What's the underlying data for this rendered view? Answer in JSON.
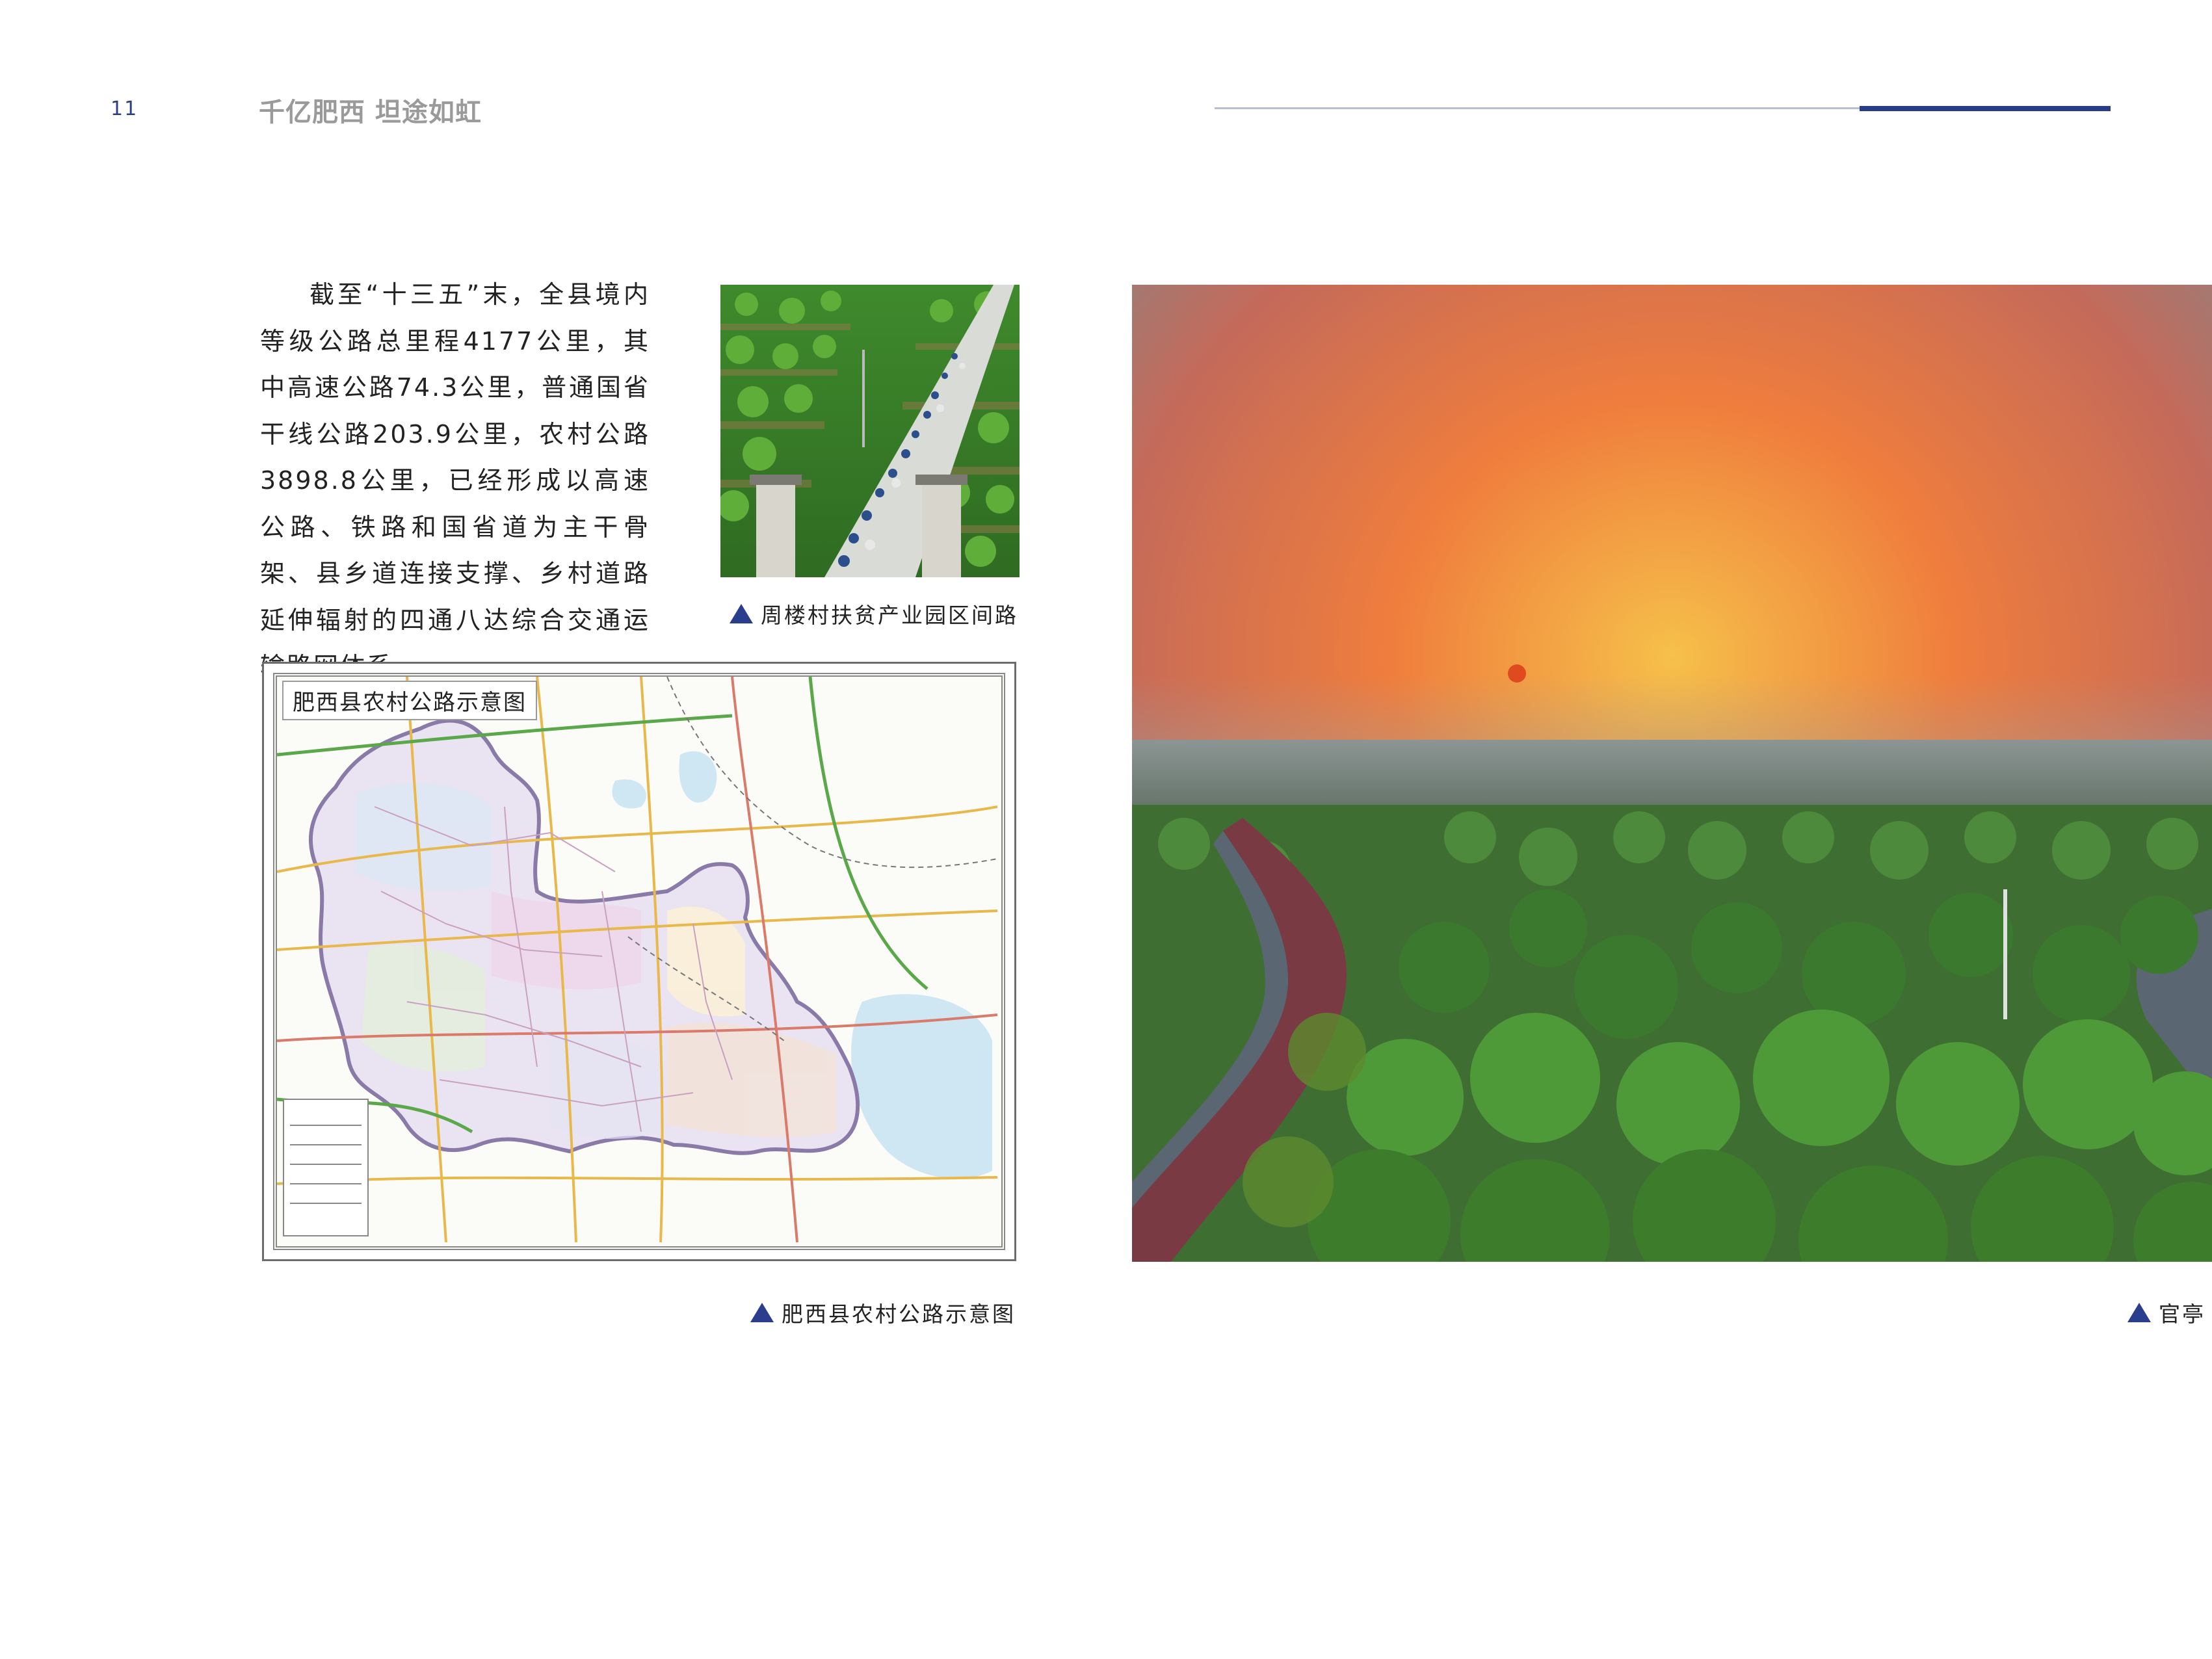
{
  "header": {
    "page_number": "11",
    "running_title": "千亿肥西  坦途如虹"
  },
  "body": {
    "paragraph": "截至“十三五”末，全县境内等级公路总里程4177公里，其中高速公路74.3公里，普通国省干线公路203.9公里，农村公路3898.8公里，已经形成以高速公路、铁路和国省道为主干骨架、县乡道连接支撑、乡村道路延伸辐射的四通八达综合交通运输路网体系。"
  },
  "figures": {
    "road_photo_caption": "周楼村扶贫产业园区间路",
    "map_title": "肥西县农村公路示意图",
    "map_caption": "肥西县农村公路示意图",
    "sunset_photo_caption": "官亭"
  },
  "colors": {
    "accent": "#283c8a",
    "header_rule": "#b7bdd2",
    "running_title": "#9a9a9a"
  }
}
